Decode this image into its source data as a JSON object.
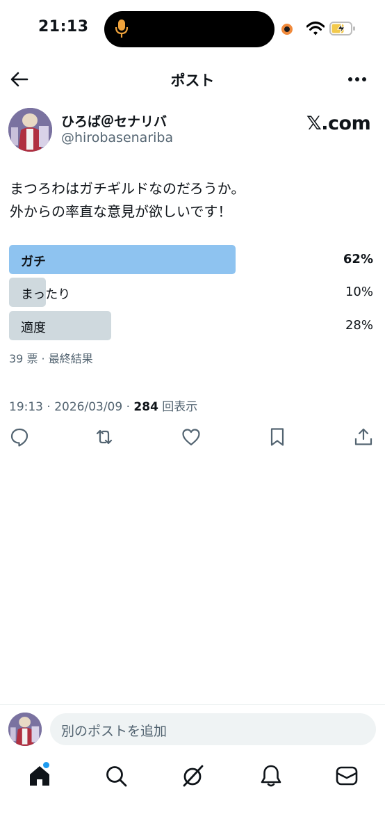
{
  "status_bar": {
    "time": "21:13"
  },
  "header": {
    "title": "ポスト"
  },
  "author": {
    "name": "ひろば＠セナリバ",
    "handle": "@hirobasenariba",
    "source_label": "𝕏.com"
  },
  "post": {
    "text_line1": "まつろわはガチギルドなのだろうか。",
    "text_line2": "外からの率直な意見が欲しいです！"
  },
  "poll": {
    "options": [
      {
        "label": "ガチ",
        "percent_text": "62%",
        "value": 62,
        "winner": true
      },
      {
        "label": "まったり",
        "percent_text": "10%",
        "value": 10,
        "winner": false
      },
      {
        "label": "適度",
        "percent_text": "28%",
        "value": 28,
        "winner": false
      }
    ],
    "meta": "39 票 · 最終結果"
  },
  "timestamp": {
    "text": "19:13 · 2026/03/09 · ",
    "views_count": "284",
    "views_label": " 回表示"
  },
  "reply": {
    "placeholder": "別のポストを追加"
  },
  "colors": {
    "text": "#0f1419",
    "secondary": "#536471",
    "poll_winner": "#8ec3f0",
    "poll_other": "#cfd9de",
    "accent": "#1d9bf0"
  },
  "icons": {
    "actions": [
      "reply-icon",
      "repost-icon",
      "like-icon",
      "bookmark-icon",
      "share-icon"
    ],
    "tabs": [
      "home-icon",
      "search-icon",
      "grok-icon",
      "notifications-icon",
      "messages-icon"
    ]
  }
}
